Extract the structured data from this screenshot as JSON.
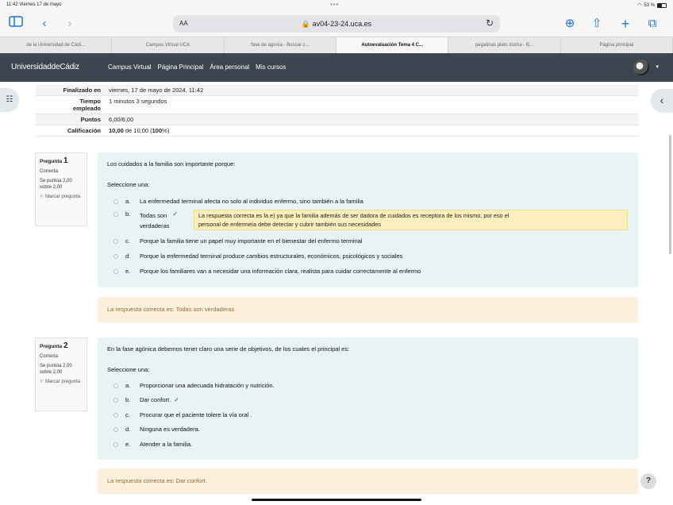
{
  "status": {
    "time": "11:42",
    "date": "Viernes 17 de mayo",
    "battery": "53 %"
  },
  "browser": {
    "aa": "AA",
    "url": "av04-23-24.uca.es",
    "tabs": [
      "de la Universidad de Cádi...",
      "Campus Virtual UCA",
      "fase de agonía - Buscar c...",
      "Autoevaluación Tema 4 C...",
      "pegatinas plato ducha - B...",
      "Página principal"
    ]
  },
  "nav": {
    "brand": "UniversidaddeCádiz",
    "links": [
      "Campus Virtual",
      "Página Principal",
      "Área personal",
      "Mis cursos"
    ]
  },
  "summary": {
    "finished_label": "Finalizado en",
    "finished_value": "viernes, 17 de mayo de 2024, 11:42",
    "time_label_1": "Tiempo",
    "time_label_2": "empleado",
    "time_value": "1 minutos 3 segundos",
    "points_label": "Puntos",
    "points_value": "6,00/6,00",
    "grade_label": "Calificación",
    "grade_bold": "10,00",
    "grade_mid": " de 10,00 (",
    "grade_pct": "100",
    "grade_end": "%)"
  },
  "questions": [
    {
      "label": "Pregunta",
      "number": "1",
      "state": "Correcta",
      "score": "Se puntúa 2,00 sobre 2,00",
      "flag": "Marcar pregunta",
      "text": "Los cuidados a la familia son importante porque:",
      "select": "Seleccione una:",
      "answers": [
        {
          "letter": "a.",
          "text": "La enfermedad terminal afecta no solo al individuo enfermo, sino también a la familia"
        },
        {
          "letter": "b.",
          "text": "Todas son",
          "text2": "verdaderas"
        },
        {
          "letter": "c.",
          "text": "Porque la familia tiene un papel muy importante en el bienestar del enfermo terminal"
        },
        {
          "letter": "d.",
          "text": "Porque la enfermedad terminal produce cambios estructurales, económicos, psicológicos y sociales"
        },
        {
          "letter": "e.",
          "text": "Porque los familiares van a necesidar una información clara, realista para cuidar correctamente al enfermo"
        }
      ],
      "feedback_1": "La respuesta correcta es la e) ya que la familia además de ser dadora de cuidados es receptora de los mismo, por eso el",
      "feedback_2": "personal de enfermeía debe detectar y cubrir también sus necesidades",
      "correct_answer": "La respuesta correcta es: Todas son verdaderas"
    },
    {
      "label": "Pregunta",
      "number": "2",
      "state": "Correcta",
      "score": "Se puntúa 2,00 sobre 2,00",
      "flag": "Marcar pregunta",
      "text": "En la fase agónica debemos tener claro una serie de objetivos, de los cuales el principal es:",
      "select": "Seleccione una:",
      "answers": [
        {
          "letter": "a.",
          "text": "Proporcionar una adecuada hidratación y nutrición."
        },
        {
          "letter": "b.",
          "text": "Dar confort."
        },
        {
          "letter": "c.",
          "text": "Procurar que el paciente tolere la vía oral ."
        },
        {
          "letter": "d.",
          "text": "Ninguna es verdadera."
        },
        {
          "letter": "e.",
          "text": "Atender a la familia."
        }
      ],
      "correct_answer": "La respuesta correcta es: Dar confort."
    }
  ],
  "help": "?"
}
